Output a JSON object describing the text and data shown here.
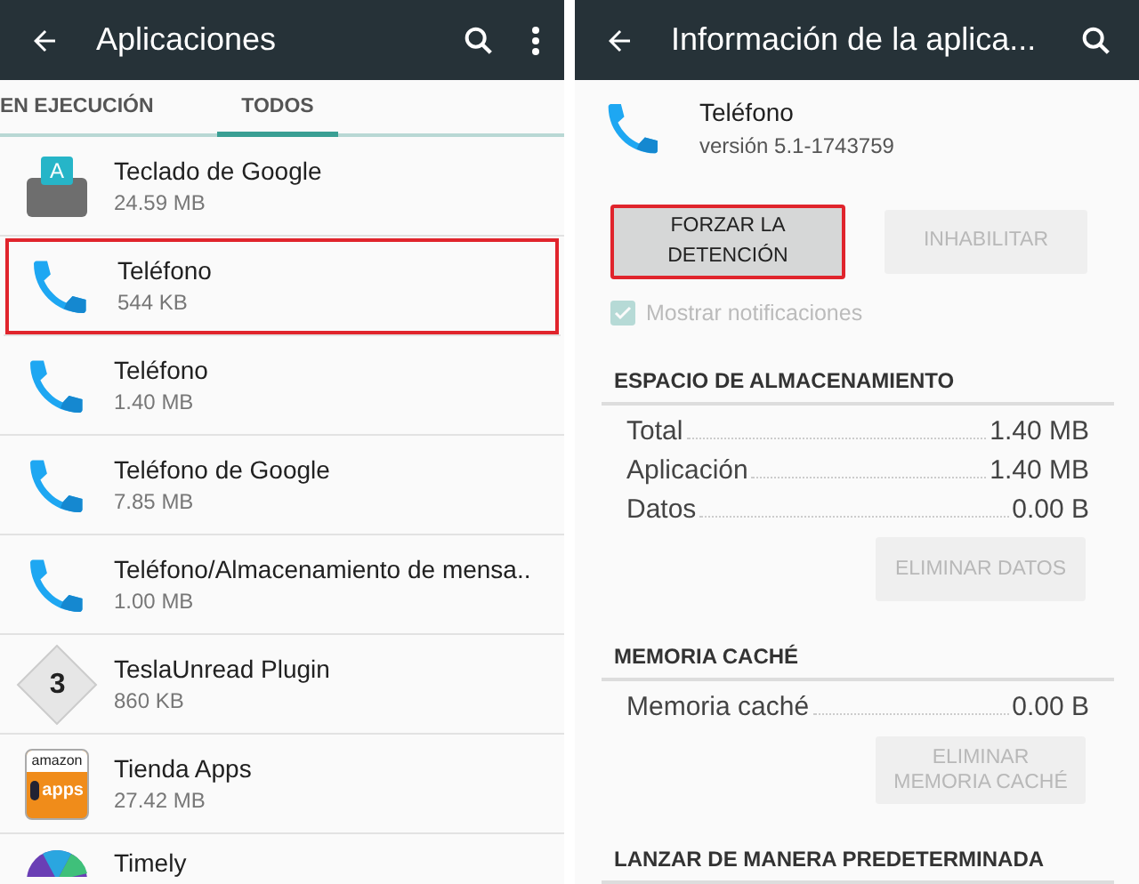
{
  "left": {
    "title": "Aplicaciones",
    "tabs": [
      {
        "label": "EN EJECUCIÓN",
        "selected": false
      },
      {
        "label": "TODOS",
        "selected": true
      }
    ],
    "apps": [
      {
        "name": "Teclado de Google",
        "size": "24.59 MB",
        "kind": "keyboard",
        "icon_label": "A",
        "highlighted": false
      },
      {
        "name": "Teléfono",
        "size": "544 KB",
        "kind": "phone",
        "highlighted": true
      },
      {
        "name": "Teléfono",
        "size": "1.40 MB",
        "kind": "phone",
        "highlighted": false
      },
      {
        "name": "Teléfono de Google",
        "size": "7.85 MB",
        "kind": "phone",
        "highlighted": false
      },
      {
        "name": "Teléfono/Almacenamiento de mensa..",
        "size": "1.00 MB",
        "kind": "phone",
        "highlighted": false
      },
      {
        "name": "TeslaUnread Plugin",
        "size": "860 KB",
        "kind": "badge",
        "icon_label": "3",
        "highlighted": false
      },
      {
        "name": "Tienda Apps",
        "size": "27.42 MB",
        "kind": "store",
        "icon_top": "amazon",
        "icon_bottom": "apps",
        "highlighted": false
      },
      {
        "name": "Timely",
        "kind": "timely",
        "highlighted": false
      }
    ]
  },
  "right": {
    "title": "Información de la aplica...",
    "app": {
      "name": "Teléfono",
      "version": "versión 5.1-1743759"
    },
    "buttons": [
      {
        "label": "FORZAR LA DETENCIÓN",
        "disabled": false,
        "highlighted": true
      },
      {
        "label": "INHABILITAR",
        "disabled": true,
        "highlighted": false
      }
    ],
    "notifications": {
      "label": "Mostrar notificaciones",
      "checked": true,
      "disabled": true
    },
    "sections": [
      {
        "header": "ESPACIO DE ALMACENAMIENTO",
        "rows": [
          {
            "label": "Total",
            "value": "1.40 MB"
          },
          {
            "label": "Aplicación",
            "value": "1.40 MB"
          },
          {
            "label": "Datos",
            "value": "0.00 B"
          }
        ],
        "button": {
          "label": "ELIMINAR DATOS",
          "disabled": true
        }
      },
      {
        "header": "MEMORIA CACHÉ",
        "rows": [
          {
            "label": "Memoria caché",
            "value": "0.00 B"
          }
        ],
        "button": {
          "label": "ELIMINAR MEMORIA CACHÉ",
          "disabled": true
        }
      },
      {
        "header": "LANZAR DE MANERA PREDETERMINADA"
      }
    ]
  }
}
